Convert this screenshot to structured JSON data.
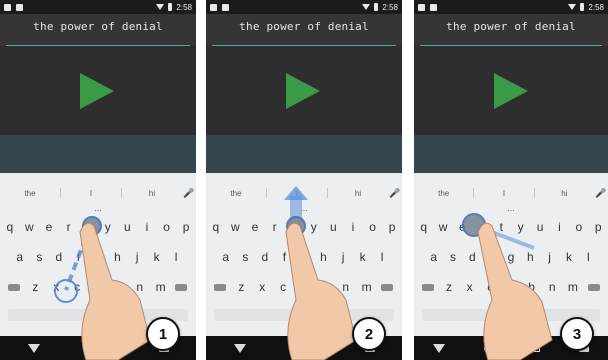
{
  "status_bar": {
    "time": "2:58"
  },
  "panels": [
    {
      "typed_text": "the power of denial",
      "step_number": "1"
    },
    {
      "typed_text": "the power of denial",
      "step_number": "2"
    },
    {
      "typed_text": "the power of denial",
      "step_number": "3"
    }
  ],
  "keyboard": {
    "suggestions": [
      "the",
      "I",
      "hi"
    ],
    "more_indicator": "...",
    "row1": [
      "q",
      "w",
      "e",
      "r",
      "t",
      "y",
      "u",
      "i",
      "o",
      "p"
    ],
    "row2": [
      "a",
      "s",
      "d",
      "f",
      "g",
      "h",
      "j",
      "k",
      "l"
    ],
    "row3": [
      "z",
      "x",
      "c",
      "v",
      "b",
      "n",
      "m"
    ]
  },
  "colors": {
    "accent": "#4fb1a6",
    "play_button": "#3a9a45",
    "gesture_blue": "#5b8fd8",
    "skin": "#f2c9a8"
  },
  "icons": {
    "mic": "microphone-icon",
    "backspace": "backspace-icon",
    "delete": "delete-icon",
    "nav_back": "nav-back-icon",
    "nav_home": "nav-home-icon",
    "nav_recent": "nav-recent-icon",
    "nav_keyboard": "keyboard-icon"
  }
}
